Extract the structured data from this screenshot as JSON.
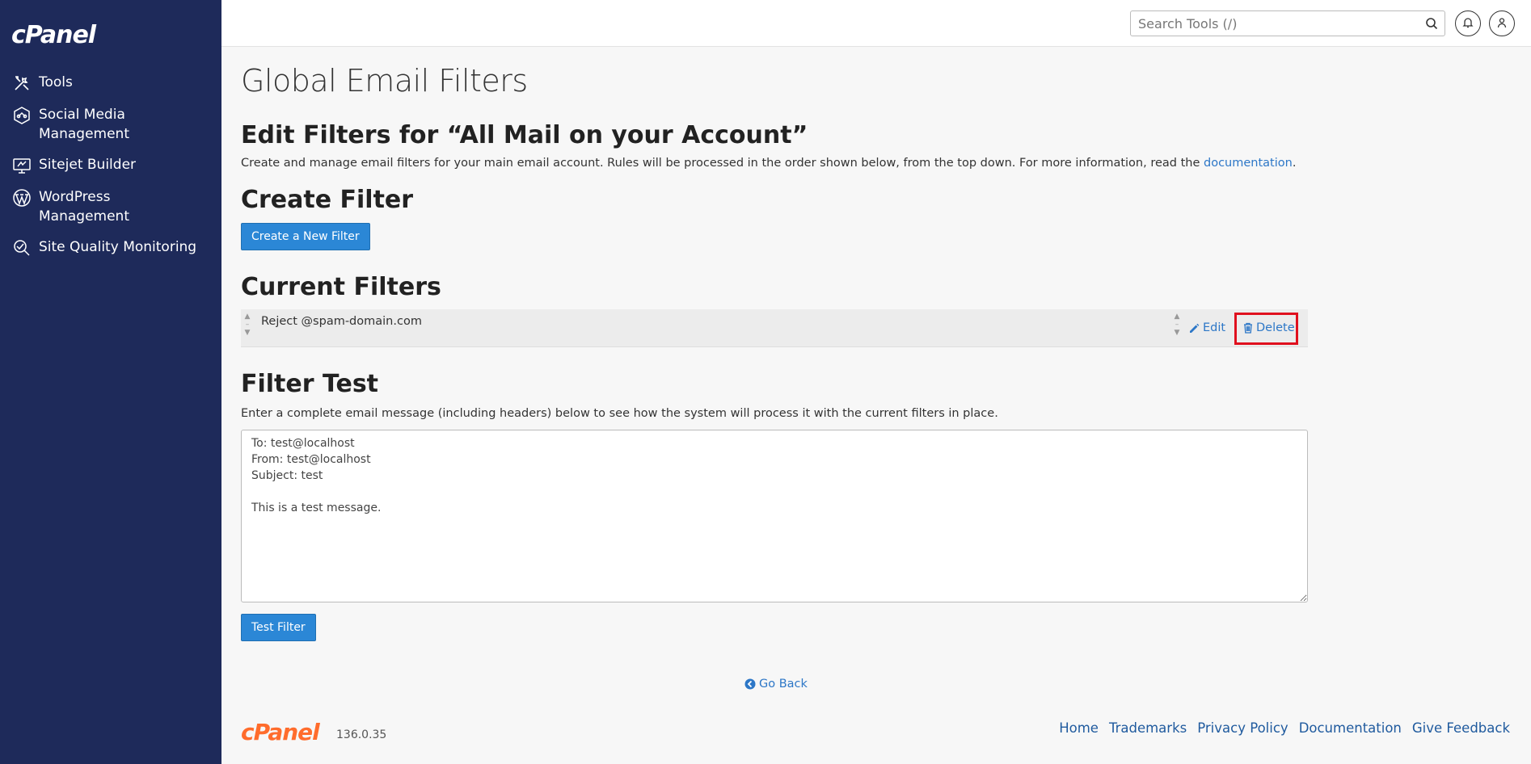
{
  "app": {
    "logo": "cPanel"
  },
  "sidebar": {
    "items": [
      {
        "label": "Tools",
        "icon": "tools-icon"
      },
      {
        "label": "Social Media Management",
        "icon": "social-media-icon"
      },
      {
        "label": "Sitejet Builder",
        "icon": "sitejet-icon"
      },
      {
        "label": "WordPress Management",
        "icon": "wordpress-icon"
      },
      {
        "label": "Site Quality Monitoring",
        "icon": "site-quality-icon"
      }
    ]
  },
  "header": {
    "search_placeholder": "Search Tools (/)"
  },
  "main": {
    "page_title": "Global Email Filters",
    "edit_heading": "Edit Filters for “All Mail on your Account”",
    "edit_description": "Create and manage email filters for your main email account. Rules will be processed in the order shown below, from the top down. For more information, read the ",
    "documentation_link": "documentation",
    "edit_description_end": ".",
    "create_heading": "Create Filter",
    "create_button": "Create a New Filter",
    "current_heading": "Current Filters",
    "filters": [
      {
        "name": "Reject @spam-domain.com",
        "edit_label": "Edit",
        "delete_label": "Delete"
      }
    ],
    "test_heading": "Filter Test",
    "test_description": "Enter a complete email message (including headers) below to see how the system will process it with the current filters in place.",
    "test_message": "To: test@localhost\nFrom: test@localhost\nSubject: test\n\nThis is a test message.",
    "test_button": "Test Filter",
    "go_back": "Go Back"
  },
  "footer": {
    "logo": "cPanel",
    "version": "136.0.35",
    "links": [
      "Home",
      "Trademarks",
      "Privacy Policy",
      "Documentation",
      "Give Feedback"
    ]
  },
  "colors": {
    "sidebar_bg": "#1e2a5a",
    "primary_button": "#2b87d6",
    "link": "#2d77c7",
    "highlight": "#e0101e",
    "footer_logo": "#ff6c2c"
  }
}
